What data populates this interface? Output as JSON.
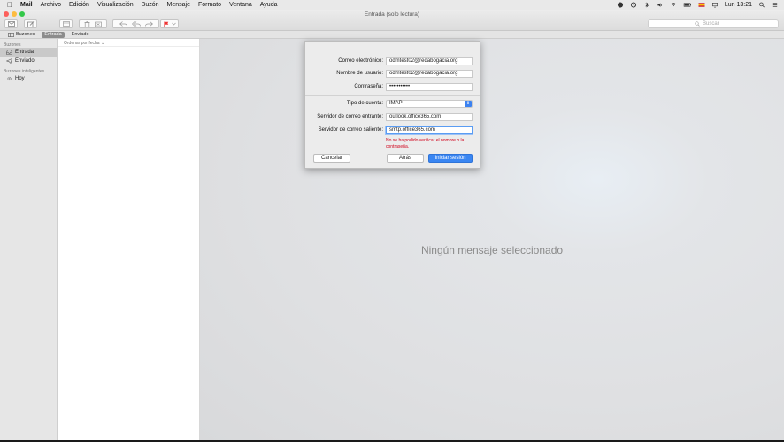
{
  "menubar": {
    "apple": "",
    "items": [
      "Mail",
      "Archivo",
      "Edición",
      "Visualización",
      "Buzón",
      "Mensaje",
      "Formato",
      "Ventana",
      "Ayuda"
    ],
    "clock": "Lun 13:21"
  },
  "window": {
    "title": "Entrada (solo lectura)",
    "search_placeholder": "Buscar"
  },
  "favorites": {
    "mailboxes": "Buzones",
    "inbox": "Entrada",
    "sent": "Enviado"
  },
  "sidebar": {
    "section_mailboxes": "Buzones",
    "items": [
      {
        "label": "Entrada"
      },
      {
        "label": "Enviado"
      }
    ],
    "section_smart": "Buzones inteligentes",
    "smart_items": [
      {
        "label": "Hoy"
      }
    ]
  },
  "message_list": {
    "sort_label": "Ordenar por fecha"
  },
  "viewer": {
    "empty_text": "Ningún mensaje seleccionado"
  },
  "dialog": {
    "email_label": "Correo electrónico:",
    "email_value": "odmtest02@redabogacia.org",
    "username_label": "Nombre de usuario:",
    "username_value": "odmtest02@redabogacia.org",
    "password_label": "Contraseña:",
    "password_value": "•••••••••••",
    "account_type_label": "Tipo de cuenta:",
    "account_type_value": "IMAP",
    "incoming_label": "Servidor de correo entrante:",
    "incoming_value": "outlook.office365.com",
    "outgoing_label": "Servidor de correo saliente:",
    "outgoing_value": "smtp.office365.com",
    "error_text": "No se ha podido verificar el nombre o la contraseña.",
    "cancel": "Cancelar",
    "back": "Atrás",
    "sign_in": "Iniciar sesión"
  },
  "colors": {
    "accent": "#3a86f2",
    "error": "#d0021b"
  }
}
